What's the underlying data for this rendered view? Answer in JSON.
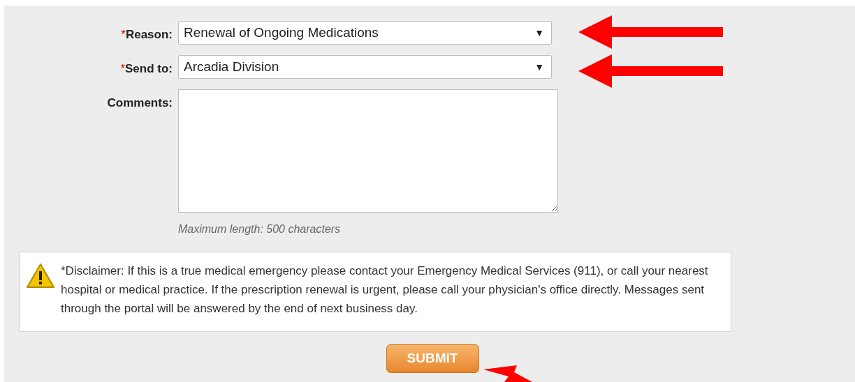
{
  "form": {
    "fields": [
      {
        "kind": "select",
        "required_mark": "*",
        "label": "Reason:",
        "value": "Renewal of Ongoing Medications",
        "caret": "▼"
      },
      {
        "kind": "select",
        "required_mark": "*",
        "label": "Send to:",
        "value": "Arcadia Division",
        "caret": "▼"
      },
      {
        "kind": "textarea",
        "label": "Comments:",
        "hint": "Maximum length: 500 characters"
      }
    ]
  },
  "disclaimer": "*Disclaimer: If this is a true medical emergency please contact your Emergency Medical Services (911), or call your nearest hospital or medical practice. If the prescription renewal is urgent, please call your physician's office directly. Messages sent through the portal will be answered by the end of next business day.",
  "submit_button": "SUBMIT"
}
